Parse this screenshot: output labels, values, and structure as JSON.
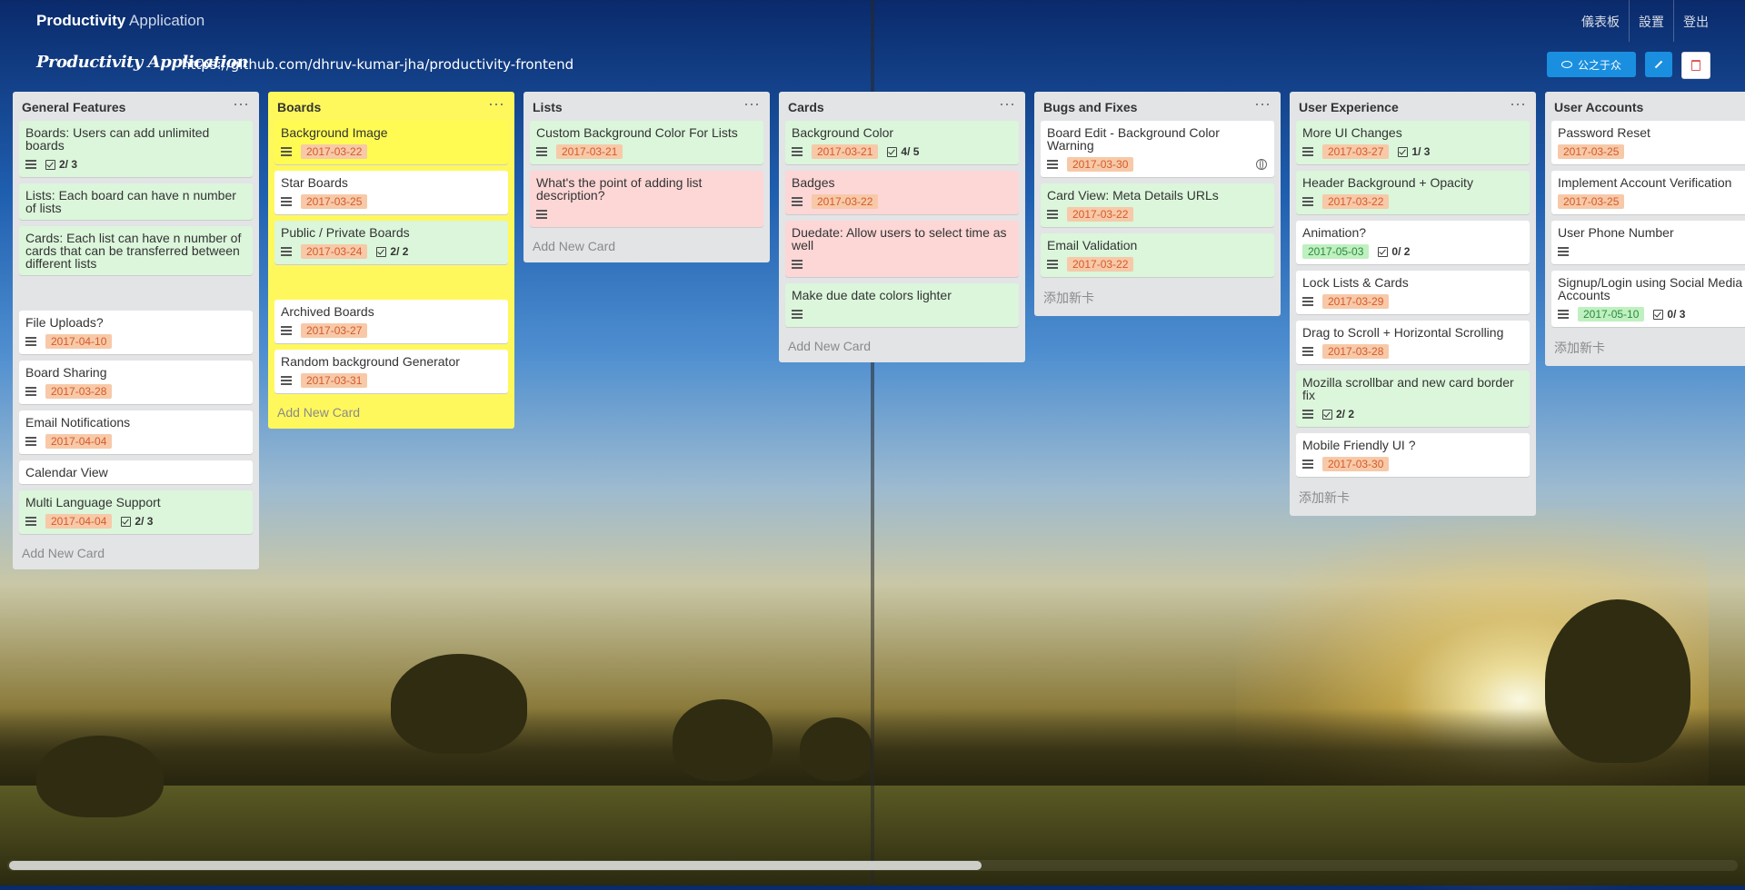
{
  "header": {
    "brand_bold": "Productivity",
    "brand_light": "Application",
    "nav": [
      "儀表板",
      "設置",
      "登出"
    ]
  },
  "board": {
    "title": "Productivity Application",
    "url": "https://github.com/dhruv-kumar-jha/productivity-frontend",
    "share_label": "公之于众",
    "edit_icon": "pencil-icon",
    "delete_icon": "trash-icon"
  },
  "lists": [
    {
      "title": "General Features",
      "add_label": "Add New Card",
      "cards": [
        {
          "title": "Boards: Users can add unlimited boards",
          "color": "green",
          "check": "2/ 3"
        },
        {
          "title": "Lists: Each board can have n number of lists",
          "color": "green"
        },
        {
          "title": "Cards: Each list can have n number of cards that can be transferred between different lists",
          "color": "green"
        },
        {
          "spacer": true
        },
        {
          "title": "File Uploads?",
          "color": "white",
          "date": "2017-04-10"
        },
        {
          "title": "Board Sharing",
          "color": "white",
          "date": "2017-03-28"
        },
        {
          "title": "Email Notifications",
          "color": "white",
          "date": "2017-04-04"
        },
        {
          "title": "Calendar View",
          "color": "white"
        },
        {
          "title": "Multi Language Support",
          "color": "green",
          "date": "2017-04-04",
          "check": "2/ 3"
        }
      ]
    },
    {
      "title": "Boards",
      "bg": "#fff85c",
      "add_label": "Add New Card",
      "cards": [
        {
          "title": "Background Image",
          "color": "yellow",
          "date": "2017-03-22"
        },
        {
          "title": "Star Boards",
          "color": "white",
          "date": "2017-03-25"
        },
        {
          "title": "Public / Private Boards",
          "color": "green",
          "date": "2017-03-24",
          "check": "2/ 2"
        },
        {
          "spacer": true
        },
        {
          "title": "Archived Boards",
          "color": "white",
          "date": "2017-03-27"
        },
        {
          "title": "Random background Generator",
          "color": "white",
          "date": "2017-03-31"
        }
      ]
    },
    {
      "title": "Lists",
      "add_label": "Add New Card",
      "cards": [
        {
          "title": "Custom Background Color For Lists",
          "color": "green",
          "date": "2017-03-21"
        },
        {
          "title": "What's the point of adding list description?",
          "color": "red",
          "icon_only": true
        }
      ]
    },
    {
      "title": "Cards",
      "add_label": "Add New Card",
      "cards": [
        {
          "title": "Background Color",
          "color": "green",
          "date": "2017-03-21",
          "check": "4/ 5"
        },
        {
          "title": "Badges",
          "color": "red",
          "date": "2017-03-22"
        },
        {
          "title": "Duedate: Allow users to select time as well",
          "color": "red",
          "icon_only": true
        },
        {
          "title": "Make due date colors lighter",
          "color": "green",
          "icon_only": true
        }
      ]
    },
    {
      "title": "Bugs and Fixes",
      "add_label": "添加新卡",
      "cards": [
        {
          "title": "Board Edit - Background Color Warning",
          "color": "white",
          "date": "2017-03-30",
          "globe": true
        },
        {
          "title": "Card View: Meta Details URLs",
          "color": "green",
          "date": "2017-03-22"
        },
        {
          "title": "Email Validation",
          "color": "green",
          "date": "2017-03-22"
        }
      ]
    },
    {
      "title": "User Experience",
      "add_label": "添加新卡",
      "cards": [
        {
          "title": "More UI Changes",
          "color": "green",
          "date": "2017-03-27",
          "check": "1/ 3"
        },
        {
          "title": "Header Background + Opacity",
          "color": "green",
          "date": "2017-03-22"
        },
        {
          "title": "Animation?",
          "color": "white",
          "date": "2017-05-03",
          "date_color": "green",
          "check": "0/ 2",
          "no_list_icon": true
        },
        {
          "title": "Lock Lists & Cards",
          "color": "white",
          "date": "2017-03-29"
        },
        {
          "title": "Drag to Scroll + Horizontal Scrolling",
          "color": "white",
          "date": "2017-03-28"
        },
        {
          "title": "Mozilla scrollbar and new card border fix",
          "color": "green",
          "check": "2/ 2"
        },
        {
          "title": "Mobile Friendly UI ?",
          "color": "white",
          "date": "2017-03-30"
        }
      ]
    },
    {
      "title": "User Accounts",
      "add_label": "添加新卡",
      "cards": [
        {
          "title": "Password Reset",
          "color": "white",
          "date": "2017-03-25",
          "no_list_icon": true
        },
        {
          "title": "Implement Account Verification",
          "color": "white",
          "date": "2017-03-25",
          "no_list_icon": true
        },
        {
          "title": "User Phone Number",
          "color": "white",
          "icon_only": true
        },
        {
          "title": "Signup/Login using Social Media Accounts",
          "color": "white",
          "date": "2017-05-10",
          "date_color": "green",
          "check": "0/ 3"
        }
      ]
    }
  ]
}
